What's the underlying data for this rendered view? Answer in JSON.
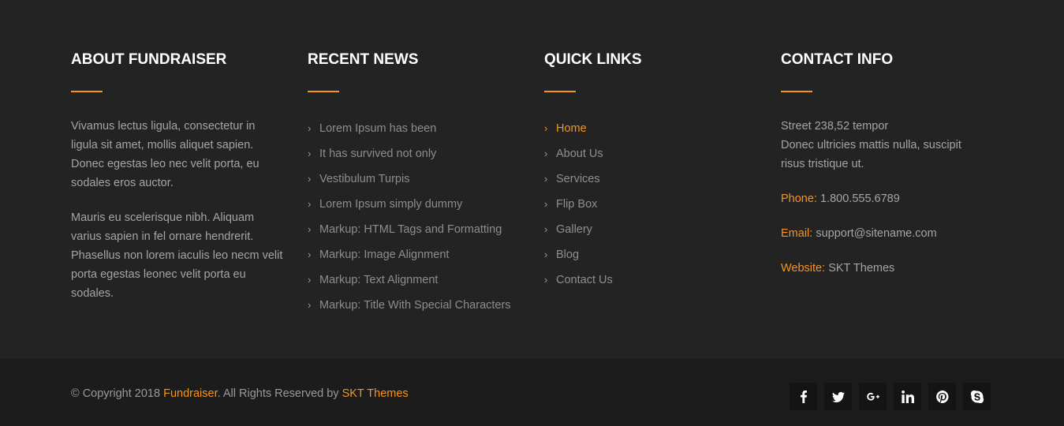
{
  "about": {
    "title": "ABOUT FUNDRAISER",
    "paragraph_1": "Vivamus lectus ligula, consectetur in ligula sit amet, mollis aliquet sapien. Donec egestas leo nec velit porta, eu sodales eros auctor.",
    "paragraph_2": "Mauris eu scelerisque nibh. Aliquam varius sapien in fel ornare hendrerit. Phasellus non lorem iaculis leo necm velit porta egestas leonec velit porta eu sodales."
  },
  "recent_news": {
    "title": "RECENT NEWS",
    "items": [
      {
        "label": "Lorem Ipsum has been"
      },
      {
        "label": "It has survived not only"
      },
      {
        "label": "Vestibulum Turpis"
      },
      {
        "label": "Lorem Ipsum simply dummy"
      },
      {
        "label": "Markup: HTML Tags and Formatting"
      },
      {
        "label": "Markup: Image Alignment"
      },
      {
        "label": "Markup: Text Alignment"
      },
      {
        "label": "Markup: Title With Special Characters"
      }
    ]
  },
  "quick_links": {
    "title": "QUICK LINKS",
    "items": [
      {
        "label": "Home",
        "active": true
      },
      {
        "label": "About Us"
      },
      {
        "label": "Services"
      },
      {
        "label": "Flip Box"
      },
      {
        "label": "Gallery"
      },
      {
        "label": "Blog"
      },
      {
        "label": "Contact Us"
      }
    ]
  },
  "contact": {
    "title": "CONTACT INFO",
    "address_line_1": "Street 238,52 tempor",
    "address_line_2": "Donec ultricies mattis nulla, suscipit risus tristique ut.",
    "phone_label": "Phone:",
    "phone_value": "1.800.555.6789",
    "email_label": "Email:",
    "email_value": "support@sitename.com",
    "website_label": "Website:",
    "website_value": "SKT Themes"
  },
  "bottom": {
    "copyright_prefix": "© Copyright 2018 ",
    "brand": "Fundraiser",
    "rights_text": ". All Rights Reserved by ",
    "author": "SKT Themes"
  },
  "social": [
    {
      "icon": "facebook-icon"
    },
    {
      "icon": "twitter-icon"
    },
    {
      "icon": "google-plus-icon"
    },
    {
      "icon": "linkedin-icon"
    },
    {
      "icon": "pinterest-icon"
    },
    {
      "icon": "skype-icon"
    }
  ],
  "colors": {
    "accent": "#f7941d",
    "background": "#232323",
    "bottom_background": "#1c1c1c",
    "social_button_background": "#141414"
  }
}
